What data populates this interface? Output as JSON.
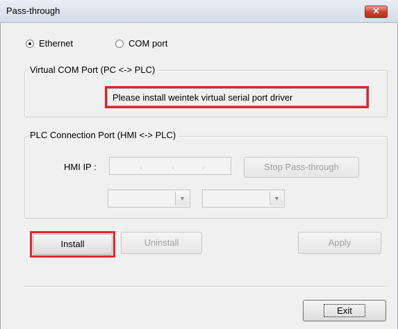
{
  "window": {
    "title": "Pass-through",
    "close_glyph": "✕"
  },
  "mode": {
    "options": [
      {
        "label": "Ethernet",
        "selected": true
      },
      {
        "label": "COM port",
        "selected": false
      }
    ]
  },
  "virtual_com": {
    "group_label": "Virtual COM Port (PC <-> PLC)",
    "status_text": "Please install weintek virtual serial port driver"
  },
  "plc_connection": {
    "group_label": "PLC Connection Port (HMI <-> PLC)",
    "hmi_ip_label": "HMI IP :",
    "ip_dots": [
      ".",
      ".",
      "."
    ],
    "stop_button_label": "Stop Pass-through",
    "combo_arrow": "▼"
  },
  "actions": {
    "install_label": "Install",
    "uninstall_label": "Uninstall",
    "apply_label": "Apply",
    "exit_label": "Exit"
  },
  "colors": {
    "highlight": "#e3242b",
    "close_button": "#c8442e"
  }
}
